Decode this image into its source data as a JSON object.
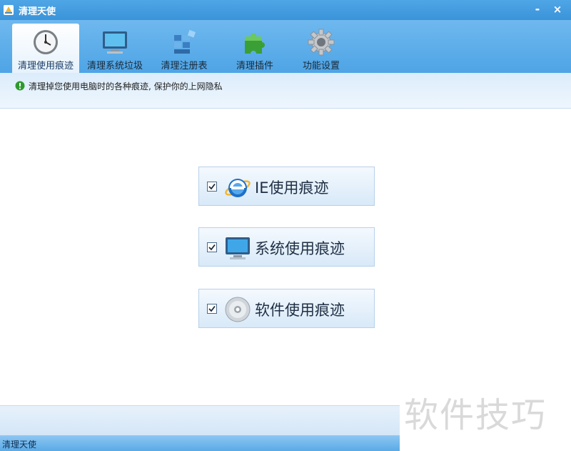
{
  "window": {
    "title": "清理天使",
    "minimize_label": "-",
    "close_label": "×"
  },
  "toolbar": {
    "tabs": [
      {
        "label": "清理使用痕迹",
        "icon": "clock-icon",
        "active": true
      },
      {
        "label": "清理系统垃圾",
        "icon": "monitor-icon",
        "active": false
      },
      {
        "label": "清理注册表",
        "icon": "registry-icon",
        "active": false
      },
      {
        "label": "清理插件",
        "icon": "puzzle-icon",
        "active": false
      },
      {
        "label": "功能设置",
        "icon": "gear-icon",
        "active": false
      }
    ]
  },
  "info": {
    "text": "清理掉您使用电脑时的各种痕迹, 保护你的上网隐私",
    "icon": "info-icon"
  },
  "options": [
    {
      "label": "IE使用痕迹",
      "checked": true,
      "icon": "ie-icon"
    },
    {
      "label": "系统使用痕迹",
      "checked": true,
      "icon": "computer-icon"
    },
    {
      "label": "软件使用痕迹",
      "checked": true,
      "icon": "disc-icon"
    }
  ],
  "status": {
    "text": "清理天使"
  },
  "watermark": {
    "text": "软件技巧"
  },
  "colors": {
    "titlebar": "#3b93d9",
    "toolbar": "#4ea4e5",
    "accent_green": "#2e9a2e"
  }
}
